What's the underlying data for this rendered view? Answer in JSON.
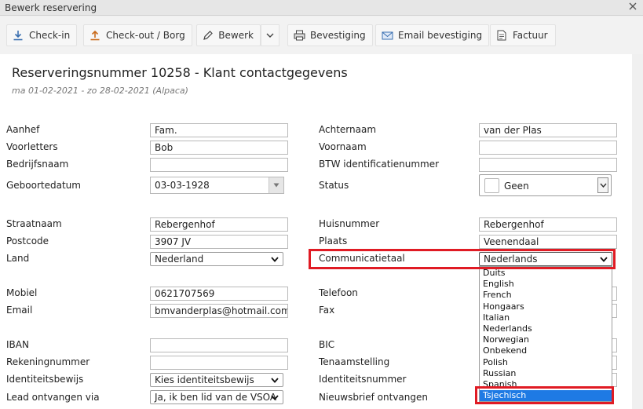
{
  "window": {
    "title": "Bewerk reservering"
  },
  "toolbar": {
    "checkin": "Check-in",
    "checkout": "Check-out / Borg",
    "edit": "Bewerk",
    "confirmation": "Bevestiging",
    "email_confirmation": "Email bevestiging",
    "invoice": "Factuur"
  },
  "header": {
    "title": "Reserveringsnummer 10258 - Klant contactgegevens",
    "subtitle": "ma 01-02-2021 - zo 28-02-2021 (Alpaca)"
  },
  "labels": {
    "aanhef": "Aanhef",
    "voorletters": "Voorletters",
    "bedrijfsnaam": "Bedrijfsnaam",
    "geboortedatum": "Geboortedatum",
    "achternaam": "Achternaam",
    "voornaam": "Voornaam",
    "btw": "BTW identificatienummer",
    "status": "Status",
    "straatnaam": "Straatnaam",
    "postcode": "Postcode",
    "land": "Land",
    "huisnummer": "Huisnummer",
    "plaats": "Plaats",
    "communicatietaal": "Communicatietaal",
    "mobiel": "Mobiel",
    "email": "Email",
    "telefoon": "Telefoon",
    "fax": "Fax",
    "iban": "IBAN",
    "rekeningnummer": "Rekeningnummer",
    "identiteitsbewijs": "Identiteitsbewijs",
    "lead": "Lead ontvangen via",
    "bic": "BIC",
    "tenaamstelling": "Tenaamstelling",
    "identiteitsnummer": "Identiteitsnummer",
    "nieuwsbrief": "Nieuwsbrief ontvangen"
  },
  "values": {
    "aanhef": "Fam.",
    "voorletters": "Bob",
    "bedrijfsnaam": "",
    "geboortedatum": "03-03-1928",
    "achternaam": "van der Plas",
    "voornaam": "",
    "btw": "",
    "status": "Geen",
    "straatnaam": "Rebergenhof",
    "postcode": "3907 JV",
    "land": "Nederland",
    "huisnummer": "Rebergenhof",
    "plaats": "Veenendaal",
    "communicatietaal": "Nederlands",
    "mobiel": "0621707569",
    "email": "bmvanderplas@hotmail.com",
    "iban": "",
    "rekeningnummer": "",
    "identiteitsbewijs": "Kies identiteitsbewijs",
    "lead": "Ja, ik ben lid van de VSOA"
  },
  "language_options": [
    "Duits",
    "English",
    "French",
    "Hongaars",
    "Italian",
    "Nederlands",
    "Norwegian",
    "Onbekend",
    "Polish",
    "Russian",
    "Spanish",
    "Tsjechisch"
  ],
  "language_selected": "Tsjechisch",
  "colors": {
    "highlight": "#e01b24",
    "selection": "#1e7ae4"
  }
}
